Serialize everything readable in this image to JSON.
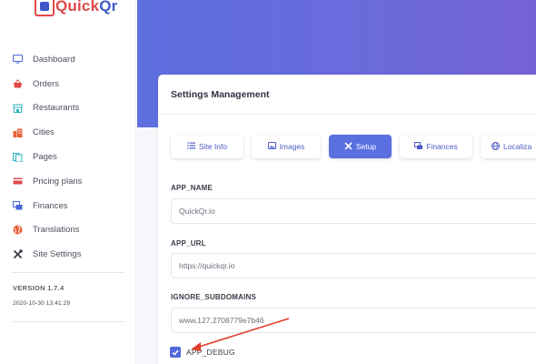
{
  "brand": {
    "name_a": "Quick",
    "name_b": "Qr"
  },
  "sidebar": {
    "items": [
      {
        "label": "Dashboard",
        "icon": "monitor-icon",
        "color": "#4a67d6"
      },
      {
        "label": "Orders",
        "icon": "basket-icon",
        "color": "#e0484a"
      },
      {
        "label": "Restaurants",
        "icon": "store-icon",
        "color": "#2bb3c0"
      },
      {
        "label": "Cities",
        "icon": "building-icon",
        "color": "#e8613a"
      },
      {
        "label": "Pages",
        "icon": "pages-icon",
        "color": "#2bb3c0"
      },
      {
        "label": "Pricing plans",
        "icon": "card-icon",
        "color": "#e0484a"
      },
      {
        "label": "Finances",
        "icon": "finance-icon",
        "color": "#4a67d6"
      },
      {
        "label": "Translations",
        "icon": "globe-icon",
        "color": "#e8613a"
      },
      {
        "label": "Site Settings",
        "icon": "tools-icon",
        "color": "#3a3e4a"
      }
    ],
    "version": "VERSION 1.7.4",
    "build_date": "2020-10-30 13:41:29"
  },
  "card": {
    "title": "Settings Management"
  },
  "tabs": [
    {
      "label": "Site Info",
      "icon": "list-icon",
      "active": false
    },
    {
      "label": "Images",
      "icon": "image-icon",
      "active": false
    },
    {
      "label": "Setup",
      "icon": "tools-icon",
      "active": true
    },
    {
      "label": "Finances",
      "icon": "finance-icon",
      "active": false
    },
    {
      "label": "Localiza",
      "icon": "globe-icon",
      "active": false
    }
  ],
  "fields": {
    "app_name": {
      "label": "APP_NAME",
      "value": "QuickQr.io"
    },
    "app_url": {
      "label": "APP_URL",
      "value": "https://quickqr.io"
    },
    "ignore_subdomains": {
      "label": "IGNORE_SUBDOMAINS",
      "value": "www,127,2708779e7b46"
    }
  },
  "app_debug": {
    "label": "APP_DEBUG",
    "checked": true
  },
  "colors": {
    "accent": "#5a6fe0",
    "header_gradient_start": "#5e6fe0",
    "header_gradient_end": "#7561d6",
    "annotation_arrow": "#e0402e"
  }
}
